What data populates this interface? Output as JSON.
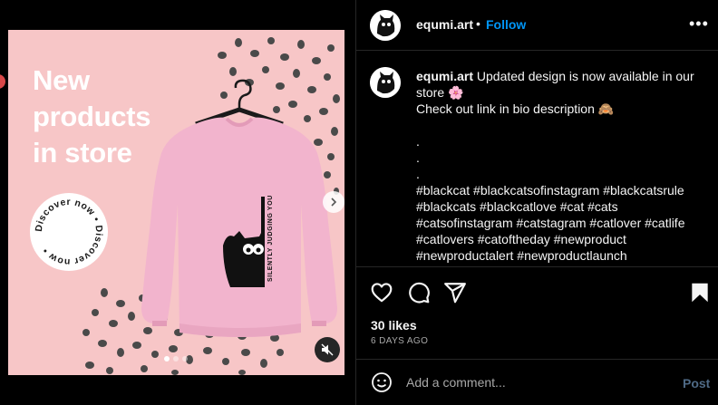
{
  "media": {
    "headline": "New\nproducts\nin store",
    "badge_text": "Discover now • Discover now • ",
    "shirt_text": "SILENTLY JUDGING YOU",
    "colors": {
      "background": "#f7c6c7",
      "sweater": "#f2b4cd",
      "dots": "#4a4a4a"
    },
    "carousel": {
      "total": 3,
      "active": 0
    }
  },
  "header": {
    "username": "equmi.art",
    "separator": "•",
    "follow_label": "Follow",
    "more_label": "•••"
  },
  "caption": {
    "username": "equmi.art",
    "line1": "Updated design is now available in our store 🌸",
    "line2": "Check out link in bio description 🙈",
    "dots": [
      ".",
      ".",
      "."
    ],
    "hashtags": "#blackcat #blackcatsofinstagram #blackcatsrule #blackcats #blackcatlove #cat #cats #catsofinstagram #catstagram #catlover #catlife #catlovers #catoftheday #newproduct #newproductalert #newproductlaunch"
  },
  "actions": {
    "icons": [
      "heart-icon",
      "comment-icon",
      "share-icon",
      "bookmark-icon"
    ]
  },
  "likes": "30 likes",
  "time": "6 DAYS AGO",
  "comment": {
    "placeholder": "Add a comment...",
    "post_label": "Post"
  }
}
